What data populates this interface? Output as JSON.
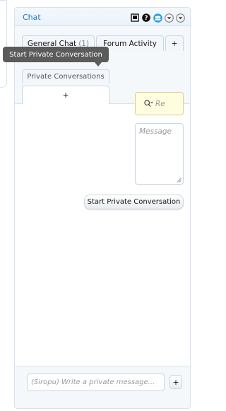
{
  "chat": {
    "title": "Chat",
    "icons": [
      "book-icon",
      "help-icon",
      "users-icon",
      "chevron-down-icon",
      "chevron-down-icon"
    ]
  },
  "tabs": {
    "general": {
      "label": "General Chat",
      "count": "(1)"
    },
    "forum": {
      "label": "Forum Activity"
    },
    "plus": "+",
    "private": {
      "label": "Private Conversations"
    },
    "new_tab": "+"
  },
  "tooltip": {
    "text": "Start Private Conversation"
  },
  "search": {
    "placeholder": "Re"
  },
  "message": {
    "placeholder": "Message"
  },
  "start_button": {
    "label": "Start Private Conversation"
  },
  "compose": {
    "placeholder": "(Siropu) Write a private message...",
    "add_label": "+"
  },
  "colors": {
    "accent": "#2577b1",
    "border": "#d8e3ee",
    "search_bg": "#fffde0",
    "tooltip_bg": "#5b5b5b"
  }
}
